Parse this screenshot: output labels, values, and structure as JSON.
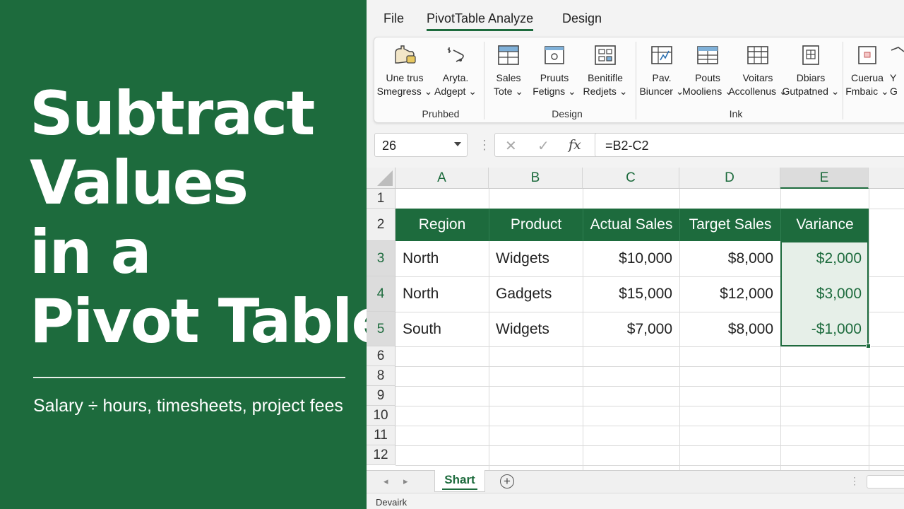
{
  "left_panel": {
    "title_lines": [
      "Subtract",
      "Values",
      "in a",
      "Pivot Table"
    ],
    "subtitle": "Salary ÷ hours, timesheets, project fees"
  },
  "menu": {
    "items": [
      {
        "label": "File"
      },
      {
        "label": "PivotTable Analyze"
      },
      {
        "label": "Design"
      }
    ],
    "active": "PivotTable Analyze"
  },
  "ribbon": {
    "buttons": [
      {
        "line1": "Une trus",
        "line2": "Smegress ⌄",
        "icon": "hand-icon"
      },
      {
        "line1": "Aryta.",
        "line2": "Adgept ⌄",
        "icon": "pen-icon"
      },
      {
        "line1": "Sales",
        "line2": "Tote ⌄",
        "icon": "table-window-icon"
      },
      {
        "line1": "Pruuts",
        "line2": "Fetigns ⌄",
        "icon": "square-dot-icon"
      },
      {
        "line1": "Benitifle",
        "line2": "Redjets ⌄",
        "icon": "grid-box-icon"
      },
      {
        "line1": "Pav.",
        "line2": "Biuncer ⌄",
        "icon": "chart-grid-icon"
      },
      {
        "line1": "Pouts",
        "line2": "Moolienѕ ⌄",
        "icon": "table-rows-icon"
      },
      {
        "line1": "Voitars",
        "line2": "Accollenus ⌄",
        "icon": "table-grid-icon"
      },
      {
        "line1": "Dbiars",
        "line2": "Gutpatned ⌄",
        "icon": "doc-grid-icon"
      },
      {
        "line1": "Cuerua",
        "line2": "Fmbaic ⌄",
        "icon": "square-red-icon"
      },
      {
        "line1": "Y",
        "line2": "G",
        "icon": "partial-icon"
      }
    ],
    "groups": [
      "Pruhbed",
      "Design",
      "Ink"
    ]
  },
  "formula_bar": {
    "name_box": "26",
    "cancel": "✕",
    "confirm": "✓",
    "fx": "fx",
    "formula": "=B2-C2"
  },
  "sheet": {
    "columns": [
      "A",
      "B",
      "C",
      "D",
      "E"
    ],
    "rows": [
      "1",
      "2",
      "3",
      "4",
      "5",
      "6",
      "8",
      "9",
      "10",
      "11",
      "12"
    ],
    "headers": [
      "Region",
      "Product",
      "Actual Sales",
      "Target Sales",
      "Variance"
    ],
    "data": [
      [
        "North",
        "Widgets",
        "$10,000",
        "$8,000",
        "$2,000"
      ],
      [
        "North",
        "Gadgets",
        "$15,000",
        "$12,000",
        "$3,000"
      ],
      [
        "South",
        "Widgets",
        "$7,000",
        "$8,000",
        "-$1,000"
      ]
    ],
    "selected_column": "E",
    "accent_color": "#1d6b3d"
  },
  "tabs": {
    "sheet_name": "Shart",
    "add": "+"
  },
  "status": {
    "text": "Devairk"
  }
}
